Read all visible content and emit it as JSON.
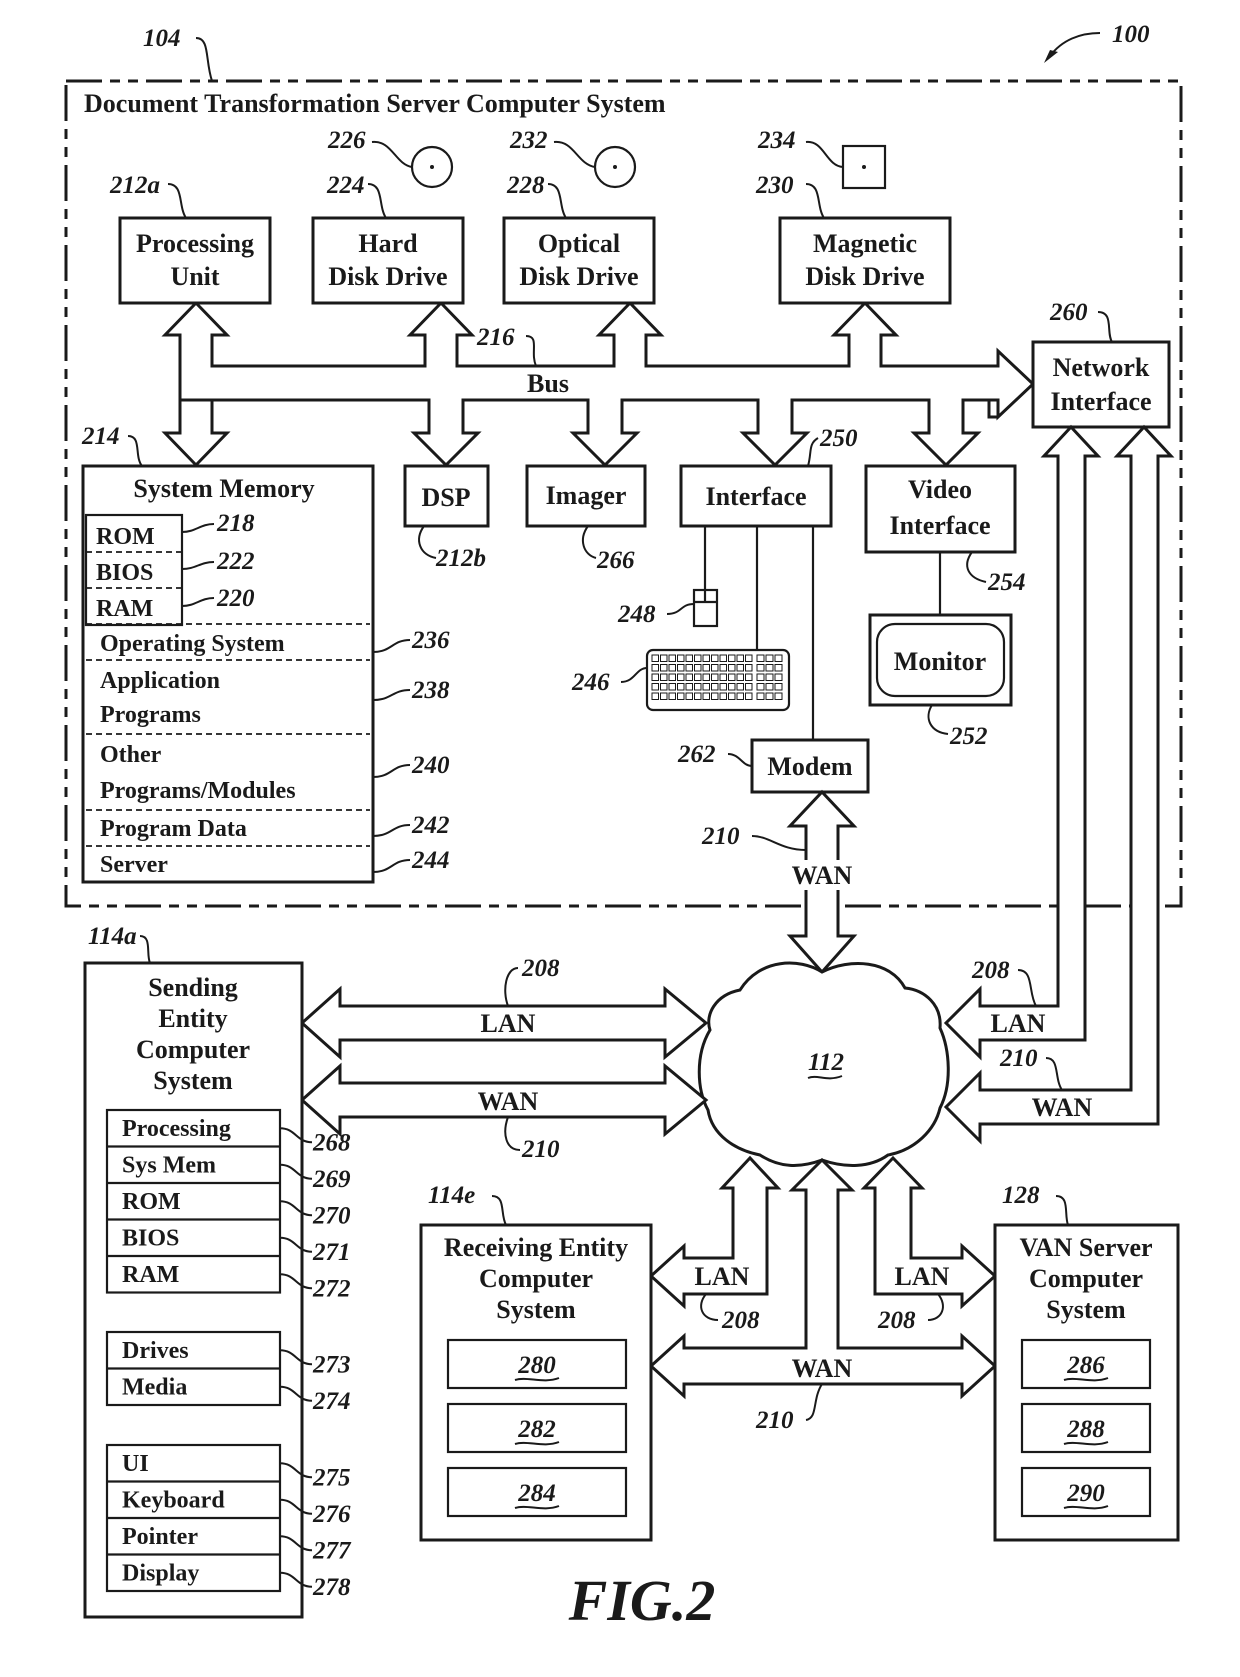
{
  "figure": {
    "caption": "FIG.2",
    "ref": "100"
  },
  "server_system": {
    "ref": "104",
    "title": "Document Transformation Server Computer System",
    "processing_unit": {
      "line1": "Processing",
      "line2": "Unit",
      "ref": "212a"
    },
    "hard_disk": {
      "line1": "Hard",
      "line2": "Disk Drive",
      "ref": "224",
      "media_ref": "226"
    },
    "optical_disk": {
      "line1": "Optical",
      "line2": "Disk Drive",
      "ref": "228",
      "media_ref": "232"
    },
    "magnetic_disk": {
      "line1": "Magnetic",
      "line2": "Disk Drive",
      "ref": "230",
      "media_ref": "234"
    },
    "bus": {
      "label": "Bus",
      "ref": "216"
    },
    "network_interface": {
      "line1": "Network",
      "line2": "Interface",
      "ref": "260"
    },
    "system_memory": {
      "title": "System Memory",
      "ref": "214",
      "rom": {
        "label": "ROM",
        "ref": "218"
      },
      "bios": {
        "label": "BIOS",
        "ref": "222"
      },
      "ram": {
        "label": "RAM",
        "ref": "220"
      },
      "rows": [
        {
          "lines": [
            "Operating System"
          ],
          "ref": "236"
        },
        {
          "lines": [
            "Application",
            "Programs"
          ],
          "ref": "238"
        },
        {
          "lines": [
            "Other",
            "Programs/Modules"
          ],
          "ref": "240"
        },
        {
          "lines": [
            "Program Data"
          ],
          "ref": "242"
        },
        {
          "lines": [
            "Server"
          ],
          "ref": "244"
        }
      ]
    },
    "dsp": {
      "label": "DSP",
      "ref": "212b"
    },
    "imager": {
      "label": "Imager",
      "ref": "266"
    },
    "interface": {
      "label": "Interface",
      "ref": "250"
    },
    "video_interface": {
      "line1": "Video",
      "line2": "Interface",
      "ref": "254"
    },
    "mouse": {
      "ref": "248"
    },
    "keyboard": {
      "ref": "246"
    },
    "monitor": {
      "label": "Monitor",
      "ref": "252"
    },
    "modem": {
      "label": "Modem",
      "ref": "262"
    },
    "modem_link": {
      "label": "WAN",
      "ref": "210"
    }
  },
  "network": {
    "ref": "112"
  },
  "links": {
    "lan": "LAN",
    "wan": "WAN",
    "lan_ref": "208",
    "wan_ref": "210"
  },
  "sending_entity": {
    "ref": "114a",
    "title": [
      "Sending",
      "Entity",
      "Computer",
      "System"
    ],
    "group1": [
      {
        "label": "Processing",
        "ref": "268"
      },
      {
        "label": "Sys Mem",
        "ref": "269"
      },
      {
        "label": "ROM",
        "ref": "270"
      },
      {
        "label": "BIOS",
        "ref": "271"
      },
      {
        "label": "RAM",
        "ref": "272"
      }
    ],
    "group2": [
      {
        "label": "Drives",
        "ref": "273"
      },
      {
        "label": "Media",
        "ref": "274"
      }
    ],
    "group3": [
      {
        "label": "UI",
        "ref": "275"
      },
      {
        "label": "Keyboard",
        "ref": "276"
      },
      {
        "label": "Pointer",
        "ref": "277"
      },
      {
        "label": "Display",
        "ref": "278"
      }
    ]
  },
  "receiving_entity": {
    "ref": "114e",
    "title": [
      "Receiving Entity",
      "Computer",
      "System"
    ],
    "items": [
      "280",
      "282",
      "284"
    ]
  },
  "van_server": {
    "ref": "128",
    "title": [
      "VAN Server",
      "Computer",
      "System"
    ],
    "items": [
      "286",
      "288",
      "290"
    ]
  }
}
